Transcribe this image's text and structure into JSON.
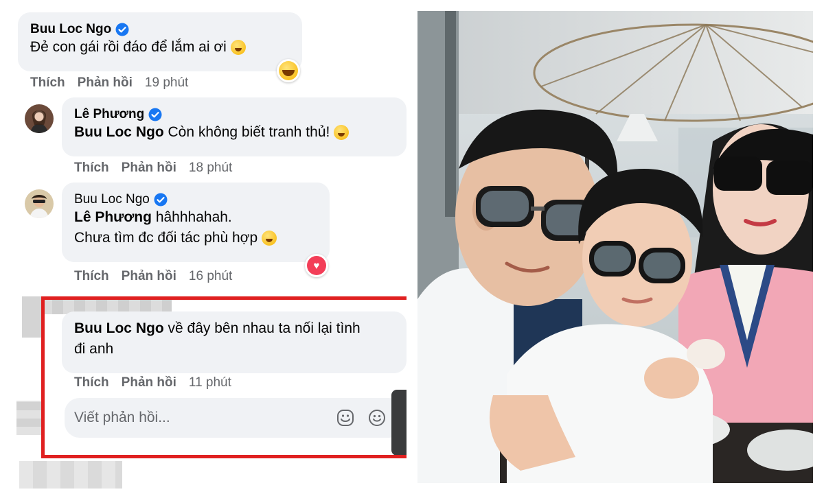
{
  "thread": {
    "comment1": {
      "author": "Buu Loc Ngo",
      "text": "Đẻ con gái rồi đáo để lắm ai ơi",
      "actions": {
        "like": "Thích",
        "reply": "Phản hồi",
        "time": "19 phút"
      }
    },
    "reply1": {
      "author": "Lê Phương",
      "mention": "Buu Loc Ngo",
      "text": "Còn không biết tranh thủ!",
      "actions": {
        "like": "Thích",
        "reply": "Phản hồi",
        "time": "18 phút"
      }
    },
    "reply2": {
      "author": "Buu Loc Ngo",
      "mention": "Lê Phương",
      "text_line1": "hâhhhahah.",
      "text_line2": "Chưa tìm đc đối tác phù hợp",
      "actions": {
        "like": "Thích",
        "reply": "Phản hồi",
        "time": "16 phút"
      }
    },
    "reply3": {
      "mention": "Buu Loc Ngo",
      "text_line1": "về đây bên nhau ta nối lại tình",
      "text_line2": "đi anh",
      "actions": {
        "like": "Thích",
        "reply": "Phản hồi",
        "time": "11 phút"
      }
    },
    "reply_box": {
      "placeholder": "Viết phản hồi...",
      "icons": [
        "sticker-icon",
        "emoji-icon"
      ]
    }
  },
  "colors": {
    "bubble": "#f0f2f5",
    "meta_text": "#65676b",
    "verified": "#1877f2",
    "highlight_border": "#e02020"
  },
  "photo": {
    "description_icon": "family-selfie-photo"
  }
}
